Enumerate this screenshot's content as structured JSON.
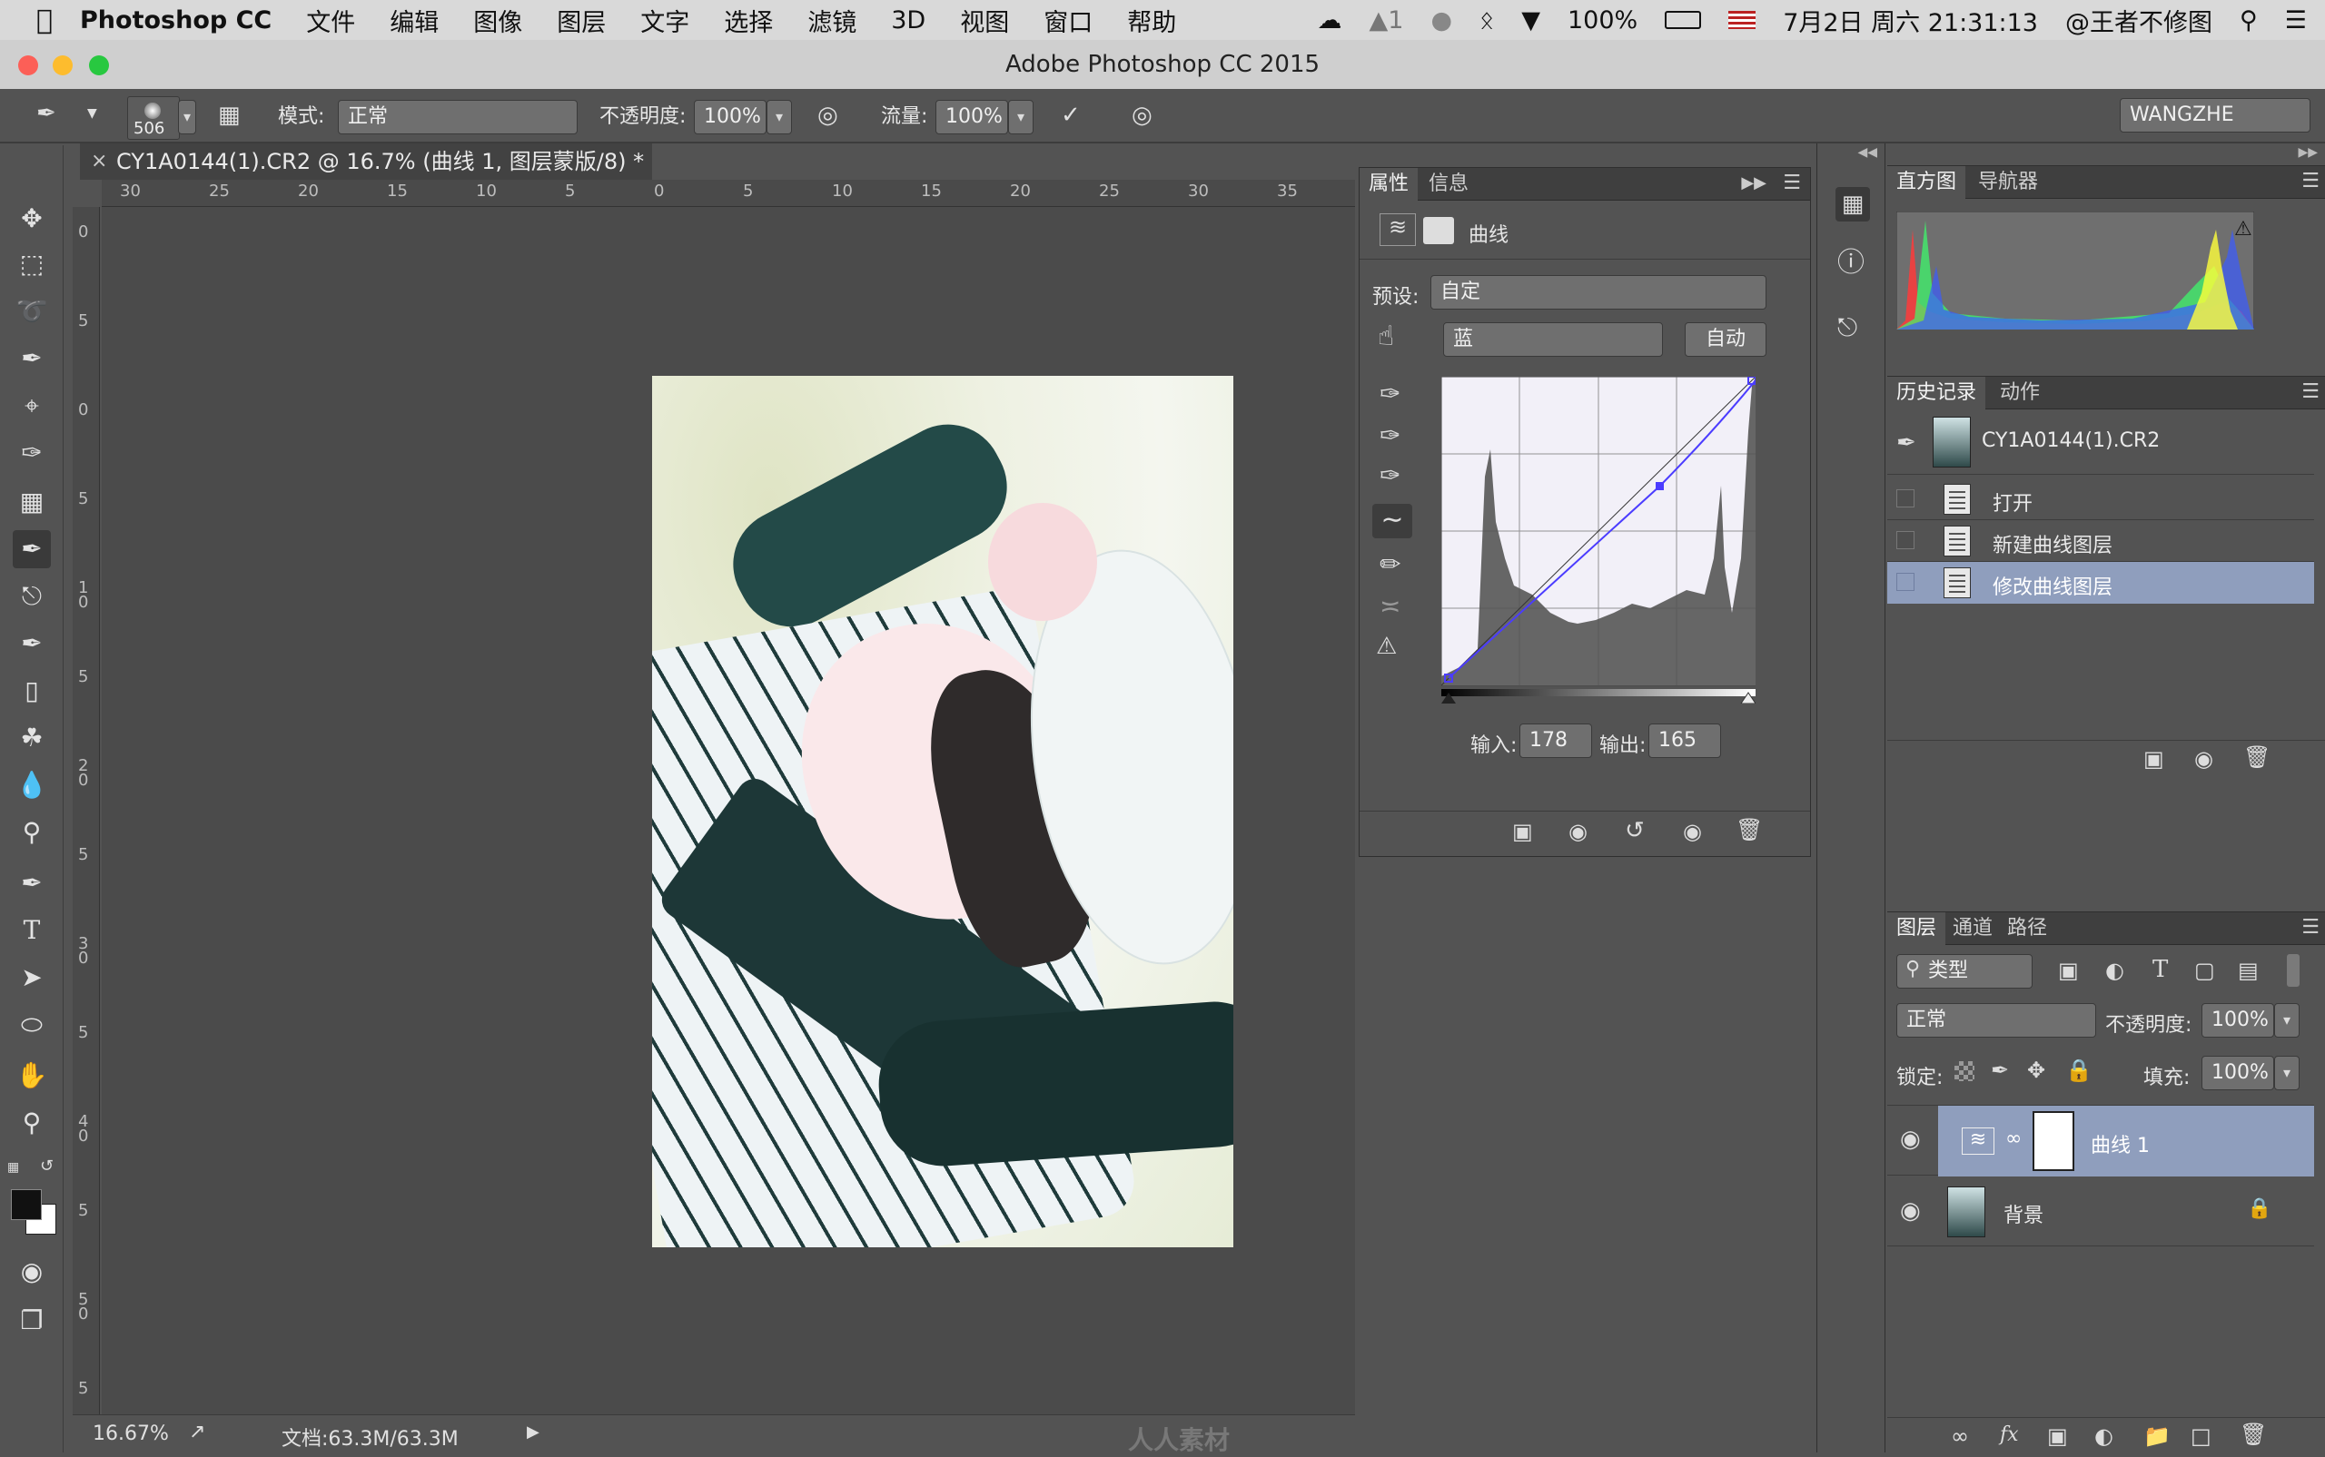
{
  "menubar": {
    "app": "Photoshop CC",
    "items": [
      "文件",
      "编辑",
      "图像",
      "图层",
      "文字",
      "选择",
      "滤镜",
      "3D",
      "视图",
      "窗口",
      "帮助"
    ],
    "badge_count": "1",
    "battery": "100%",
    "datetime": "7月2日 周六  21:31:13",
    "user": "@王者不修图"
  },
  "window": {
    "title": "Adobe Photoshop CC 2015"
  },
  "options": {
    "brush_size": "506",
    "mode_label": "模式:",
    "mode_value": "正常",
    "opacity_label": "不透明度:",
    "opacity_value": "100%",
    "flow_label": "流量:",
    "flow_value": "100%",
    "workspace": "WANGZHE"
  },
  "document": {
    "tab_title": "CY1A0144(1).CR2 @ 16.7% (曲线 1, 图层蒙版/8) *",
    "ruler_top": [
      "30",
      "25",
      "20",
      "15",
      "10",
      "5",
      "0",
      "5",
      "10",
      "15",
      "20",
      "25",
      "30",
      "35"
    ],
    "ruler_left": [
      "0",
      "5",
      "0",
      "5",
      "1 0",
      "5",
      "2 0",
      "5",
      "3 0",
      "5",
      "4 0",
      "5",
      "5 0",
      "5"
    ]
  },
  "status": {
    "zoom": "16.67%",
    "doc_size": "文档:63.3M/63.3M"
  },
  "properties": {
    "tabs": [
      "属性",
      "信息"
    ],
    "adjustment": "曲线",
    "preset_label": "预设:",
    "preset_value": "自定",
    "channel_value": "蓝",
    "auto_label": "自动",
    "input_label": "输入:",
    "input_value": "178",
    "output_label": "输出:",
    "output_value": "165"
  },
  "histogram": {
    "tabs": [
      "直方图",
      "导航器"
    ]
  },
  "history": {
    "tabs": [
      "历史记录",
      "动作"
    ],
    "snapshot": "CY1A0144(1).CR2",
    "steps": [
      "打开",
      "新建曲线图层",
      "修改曲线图层"
    ]
  },
  "layers": {
    "tabs": [
      "图层",
      "通道",
      "路径"
    ],
    "filter": "类型",
    "blend_mode": "正常",
    "opacity_label": "不透明度:",
    "opacity_value": "100%",
    "lock_label": "锁定:",
    "fill_label": "填充:",
    "fill_value": "100%",
    "items": [
      {
        "name": "曲线 1"
      },
      {
        "name": "背景"
      }
    ]
  },
  "watermark": "人人素材",
  "colors": {
    "selection": "#8f9ebd",
    "panel": "#535353",
    "curve_line": "#4b3cff"
  }
}
